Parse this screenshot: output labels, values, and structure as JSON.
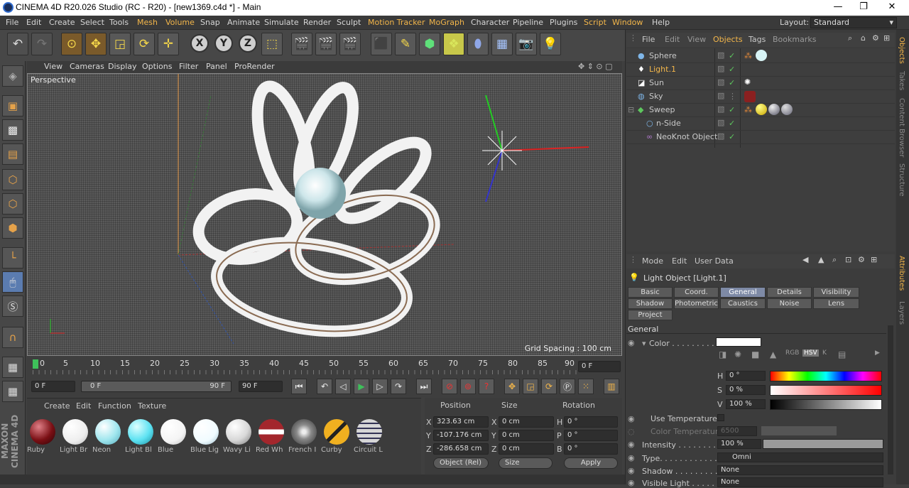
{
  "window": {
    "title": "CINEMA 4D R20.026 Studio (RC - R20) - [new1369.c4d *] - Main",
    "minimize": "—",
    "maximize": "❐",
    "close": "✕"
  },
  "menu": [
    "File",
    "Edit",
    "Create",
    "Select",
    "Tools",
    "Mesh",
    "Volume",
    "Snap",
    "Animate",
    "Simulate",
    "Render",
    "Sculpt",
    "Motion Tracker",
    "MoGraph",
    "Character",
    "Pipeline",
    "Plugins",
    "Script",
    "Window",
    "Help"
  ],
  "layout": {
    "label": "Layout:",
    "value": "Standard"
  },
  "viewport": {
    "menu": [
      "View",
      "Cameras",
      "Display",
      "Options",
      "Filter",
      "Panel",
      "ProRender"
    ],
    "label": "Perspective",
    "grid_spacing": "Grid Spacing : 100 cm"
  },
  "timeline": {
    "ticks": [
      "0",
      "5",
      "10",
      "15",
      "20",
      "25",
      "30",
      "35",
      "40",
      "45",
      "50",
      "55",
      "60",
      "65",
      "70",
      "75",
      "80",
      "85",
      "90"
    ],
    "current_frame": "0 F"
  },
  "transport": {
    "start": "0 F",
    "range_start": "0 F",
    "range_end": "90 F",
    "end": "90 F"
  },
  "materials": {
    "menu": [
      "Create",
      "Edit",
      "Function",
      "Texture"
    ],
    "items": [
      {
        "name": "Ruby",
        "color": "#7a0f14"
      },
      {
        "name": "Light Br",
        "color": "#ffffff"
      },
      {
        "name": "Neon",
        "color": "#9fe6ee"
      },
      {
        "name": "Light Bl",
        "color": "#5de2f2"
      },
      {
        "name": "Blue",
        "color": "#ffffff"
      },
      {
        "name": "Blue Lig",
        "color": "#f0fbff"
      },
      {
        "name": "Wavy Li",
        "color": "#d8d8d8"
      },
      {
        "name": "Red Wh",
        "color": "#a3262c"
      },
      {
        "name": "French I",
        "color": "#8a8a8a"
      },
      {
        "name": "Curby",
        "color": "#f0b020"
      },
      {
        "name": "Circuit L",
        "color": "#d6d6d6"
      }
    ]
  },
  "coords": {
    "headers": [
      "Position",
      "Size",
      "Rotation"
    ],
    "rows": [
      {
        "axis": "X",
        "pos": "323.63 cm",
        "saxis": "X",
        "size": "0 cm",
        "raxis": "H",
        "rot": "0 °"
      },
      {
        "axis": "Y",
        "pos": "-107.176 cm",
        "saxis": "Y",
        "size": "0 cm",
        "raxis": "P",
        "rot": "0 °"
      },
      {
        "axis": "Z",
        "pos": "-286.658 cm",
        "saxis": "Z",
        "size": "0 cm",
        "raxis": "B",
        "rot": "0 °"
      }
    ],
    "mode": "Object (Rel)",
    "size_mode": "Size",
    "apply": "Apply"
  },
  "objects_panel": {
    "tabs": [
      "File",
      "Edit",
      "View",
      "Objects",
      "Tags",
      "Bookmarks"
    ],
    "items": [
      "Sphere",
      "Light.1",
      "Sun",
      "Sky",
      "Sweep",
      "n-Side",
      "NeoKnot Object"
    ]
  },
  "attributes": {
    "menu": [
      "Mode",
      "Edit",
      "User Data"
    ],
    "title": "Light Object [Light.1]",
    "tabs": [
      "Basic",
      "Coord.",
      "General",
      "Details",
      "Visibility",
      "Shadow",
      "Photometric",
      "Caustics",
      "Noise",
      "Lens",
      "Project"
    ],
    "section": "General",
    "color_label": "Color . . . . . . . . . .",
    "h_label": "H",
    "h_value": "0 °",
    "s_label": "S",
    "s_value": "0 %",
    "v_label": "V",
    "v_value": "100 %",
    "use_temp": "Use Temperature",
    "color_temp": "Color Temperature",
    "color_temp_value": "6500",
    "intensity_label": "Intensity . . . . . . . .",
    "intensity_value": "100 %",
    "intensity_level": 1.0,
    "type_label": "Type. . . . . . . . . . . .",
    "type_value": "Omni",
    "shadow_label": "Shadow . . . . . . . . .",
    "shadow_value": "None",
    "visible_label": "Visible Light . . . . . .",
    "visible_value": "None"
  },
  "side_tabs": [
    "Objects",
    "Takes",
    "Content Browser",
    "Structure",
    "Attributes",
    "Layers"
  ],
  "brand": "MAXON CINEMA 4D"
}
